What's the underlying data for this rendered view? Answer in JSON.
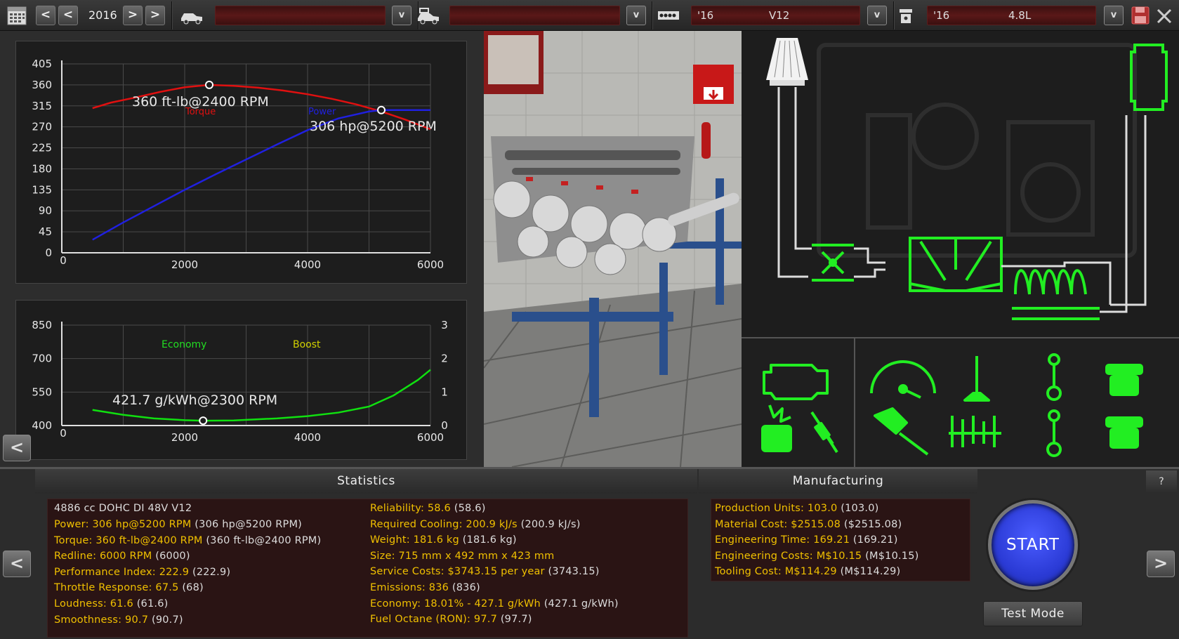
{
  "topbar": {
    "calendar_icon": "calendar-icon",
    "prev_prev": "<",
    "prev": "<",
    "year": "2016",
    "next": ">",
    "next_next": ">",
    "car_model_value": "",
    "car_trim_value": "",
    "dropdown_label": "v",
    "engine_family_year": "'16",
    "engine_family_name": "V12",
    "engine_variant_year": "'16",
    "engine_variant_name": "4.8L"
  },
  "torque_chart_labels": {
    "torque_legend": "Torque",
    "power_legend": "Power",
    "torque_peak": "360 ft-lb@2400 RPM",
    "power_peak": "306 hp@5200 RPM"
  },
  "economy_chart_labels": {
    "economy_legend": "Economy",
    "boost_legend": "Boost",
    "economy_min": "421.7 g/kWh@2300 RPM"
  },
  "chart_data": [
    {
      "type": "line",
      "title": "",
      "xlabel": "",
      "ylabel": "",
      "xlim": [
        0,
        6000
      ],
      "ylim": [
        0,
        405
      ],
      "x_ticks": [
        0,
        2000,
        4000,
        6000
      ],
      "y_ticks": [
        0,
        45,
        90,
        135,
        180,
        225,
        270,
        315,
        360,
        405
      ],
      "grid": true,
      "legend": "top-center",
      "series": [
        {
          "name": "Torque",
          "color": "#e01010",
          "x": [
            500,
            800,
            1200,
            1600,
            2000,
            2400,
            2800,
            3200,
            3600,
            4000,
            4400,
            4800,
            5200,
            5600,
            6000
          ],
          "values": [
            310,
            322,
            333,
            345,
            355,
            360,
            358,
            354,
            348,
            340,
            330,
            318,
            303,
            285,
            265
          ]
        },
        {
          "name": "Power",
          "color": "#2020e0",
          "x": [
            500,
            1000,
            1500,
            2000,
            2500,
            3000,
            3500,
            4000,
            4500,
            5000,
            5200,
            5600,
            6000
          ],
          "values": [
            28,
            65,
            100,
            135,
            168,
            200,
            232,
            263,
            288,
            303,
            306,
            306,
            306
          ]
        }
      ],
      "annotations": [
        {
          "text": "360 ft-lb@2400 RPM",
          "x": 2400,
          "y": 360
        },
        {
          "text": "306 hp@5200 RPM",
          "x": 5200,
          "y": 306
        }
      ]
    },
    {
      "type": "line",
      "title": "",
      "xlabel": "",
      "ylabel": "",
      "xlim": [
        0,
        6000
      ],
      "ylim": [
        400,
        850
      ],
      "y2lim": [
        0,
        3
      ],
      "x_ticks": [
        0,
        2000,
        4000,
        6000
      ],
      "y_ticks": [
        400,
        550,
        700,
        850
      ],
      "y2_ticks": [
        0,
        1,
        2,
        3
      ],
      "grid": true,
      "legend": "top-center",
      "series": [
        {
          "name": "Economy",
          "color": "#10e010",
          "x": [
            500,
            1000,
            1500,
            2000,
            2300,
            2800,
            3500,
            4000,
            4500,
            5000,
            5400,
            5800,
            6000
          ],
          "values": [
            470,
            448,
            432,
            424,
            421.7,
            423,
            432,
            442,
            458,
            485,
            535,
            605,
            650
          ]
        },
        {
          "name": "Boost",
          "color": "#d0d000",
          "x": [],
          "values": []
        }
      ],
      "annotations": [
        {
          "text": "421.7 g/kWh@2300 RPM",
          "x": 2300,
          "y": 421.7
        }
      ]
    }
  ],
  "chart_back": "<",
  "statistics": {
    "header": "Statistics",
    "engine_desc": "4886 cc DOHC DI 48V V12",
    "left": [
      {
        "k": "Power: 306 hp@5200 RPM",
        "v": " (306 hp@5200 RPM)"
      },
      {
        "k": "Torque: 360 ft-lb@2400 RPM",
        "v": " (360 ft-lb@2400 RPM)"
      },
      {
        "k": "Redline: 6000 RPM",
        "v": " (6000)"
      },
      {
        "k": "Performance Index: 222.9",
        "v": " (222.9)"
      },
      {
        "k": "Throttle Response: 67.5",
        "v": " (68)"
      },
      {
        "k": "Loudness: 61.6",
        "v": " (61.6)"
      },
      {
        "k": "Smoothness: 90.7",
        "v": " (90.7)"
      }
    ],
    "right": [
      {
        "k": "Reliability: 58.6",
        "v": " (58.6)"
      },
      {
        "k": "Required Cooling: 200.9 kJ/s",
        "v": " (200.9 kJ/s)"
      },
      {
        "k": "Weight: 181.6 kg",
        "v": " (181.6 kg)"
      },
      {
        "k": "Size: 715 mm x 492 mm x 423 mm",
        "v": ""
      },
      {
        "k": "Service Costs: $3743.15 per year",
        "v": " (3743.15)"
      },
      {
        "k": "Emissions: 836",
        "v": " (836)"
      },
      {
        "k": "Economy: 18.01% - 427.1 g/kWh",
        "v": " (427.1 g/kWh)"
      },
      {
        "k": "Fuel Octane (RON): 97.7",
        "v": " (97.7)"
      }
    ]
  },
  "manufacturing": {
    "header": "Manufacturing",
    "rows": [
      {
        "k": "Production Units: 103.0",
        "v": " (103.0)"
      },
      {
        "k": "Material Cost: $2515.08",
        "v": " ($2515.08)"
      },
      {
        "k": "Engineering Time: 169.21",
        "v": " (169.21)"
      },
      {
        "k": "Engineering Costs: M$10.15",
        "v": " (M$10.15)"
      },
      {
        "k": "Tooling Cost: M$114.29",
        "v": " (M$114.29)"
      }
    ]
  },
  "actions": {
    "help": "?",
    "back": "<",
    "forward": ">",
    "start": "START",
    "test_mode": "Test Mode"
  },
  "colors": {
    "accent_green": "#22ee22",
    "stat_key": "#f0c000",
    "field_red": "#5a1818",
    "start_blue": "#2b3bd6"
  }
}
